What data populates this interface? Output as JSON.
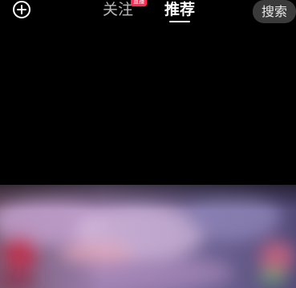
{
  "top_bar": {
    "add_icon": "plus-circle-icon",
    "tabs": [
      {
        "label": "关注",
        "active": false,
        "badge": "直播"
      },
      {
        "label": "推荐",
        "active": true
      }
    ],
    "search_label": "搜索"
  },
  "colors": {
    "background": "#000000",
    "active_tab": "#ffffff",
    "inactive_tab": "#b9b9b9",
    "badge": "#fe2c55",
    "search_bg": "#3a3a3a"
  },
  "feed": {
    "content": "blurred-video-thumbnail"
  }
}
